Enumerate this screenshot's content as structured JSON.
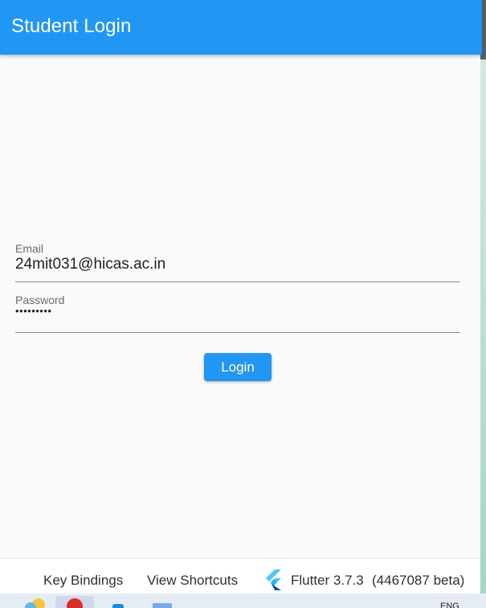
{
  "appbar": {
    "title": "Student Login"
  },
  "form": {
    "email": {
      "label": "Email",
      "value": "24mit031@hicas.ac.in"
    },
    "password": {
      "label": "Password",
      "value": "•••••••••"
    },
    "login_label": "Login"
  },
  "bottom_bar": {
    "key_bindings": "Key Bindings",
    "view_shortcuts": "View Shortcuts",
    "flutter_version": "Flutter 3.7.3",
    "flutter_build": "(4467087 beta)"
  },
  "taskbar": {
    "lang": "ENG"
  },
  "colors": {
    "primary": "#2196f3",
    "background": "#fafafa"
  }
}
